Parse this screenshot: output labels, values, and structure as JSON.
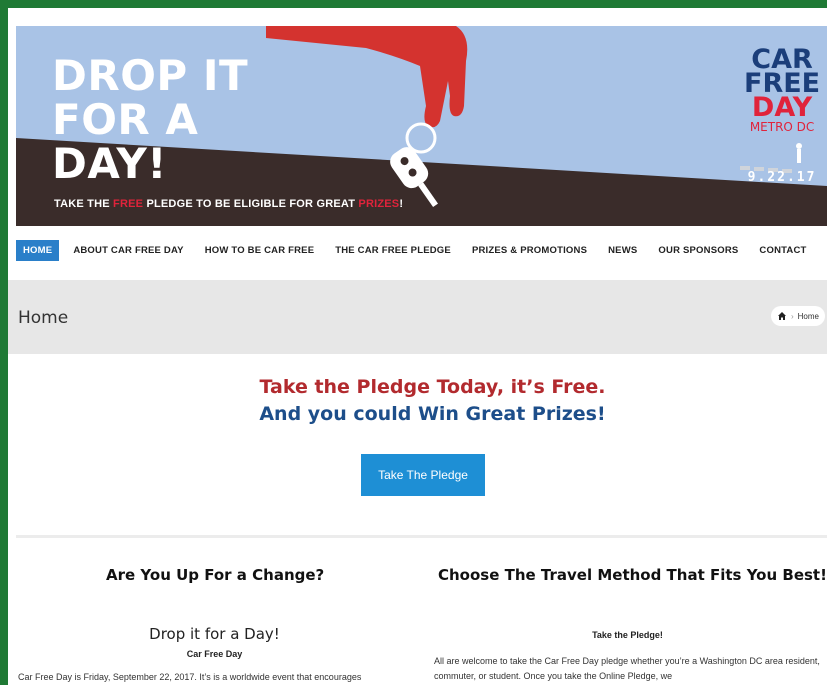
{
  "banner": {
    "headline_lines": [
      "DROP IT",
      "FOR A",
      "DAY!"
    ],
    "tagline_before": "TAKE THE ",
    "tagline_free": "FREE",
    "tagline_middle": " PLEDGE TO BE ELIGIBLE FOR GREAT ",
    "tagline_prizes": "PRIZES",
    "tagline_end": "!",
    "logo_lines": [
      "CAR",
      "FREE",
      "DAY"
    ],
    "logo_sub": "METRO DC",
    "logo_date": "9.22.17"
  },
  "nav": {
    "items": [
      {
        "label": "HOME",
        "active": true
      },
      {
        "label": "ABOUT CAR FREE DAY",
        "active": false
      },
      {
        "label": "HOW TO BE CAR FREE",
        "active": false
      },
      {
        "label": "THE CAR FREE PLEDGE",
        "active": false
      },
      {
        "label": "PRIZES & PROMOTIONS",
        "active": false
      },
      {
        "label": "NEWS",
        "active": false
      },
      {
        "label": "OUR SPONSORS",
        "active": false
      },
      {
        "label": "CONTACT",
        "active": false
      }
    ]
  },
  "title_bar": {
    "title": "Home",
    "breadcrumb": "Home"
  },
  "pledge": {
    "line1": "Take the Pledge Today, it’s Free.",
    "line2": "And you could Win Great Prizes!",
    "button": "Take The Pledge"
  },
  "left_col": {
    "heading": "Are You Up For a Change?",
    "subheading": "Drop it for a Day!",
    "label": "Car Free Day",
    "body": "Car Free Day is Friday, September 22, 2017.  It’s is a worldwide event that encourages"
  },
  "right_col": {
    "heading": "Choose The Travel Method That Fits You Best!",
    "label": "Take the Pledge!",
    "body": "All are welcome to take the Car Free Day pledge whether you’re a Washington DC area resident, commuter, or student.  Once you take the Online Pledge, we"
  },
  "colors": {
    "accent_blue": "#2a7fc9",
    "pledge_red": "#b22a2e",
    "pledge_blue": "#1d4e8a",
    "frame_green": "#1f7a35"
  }
}
